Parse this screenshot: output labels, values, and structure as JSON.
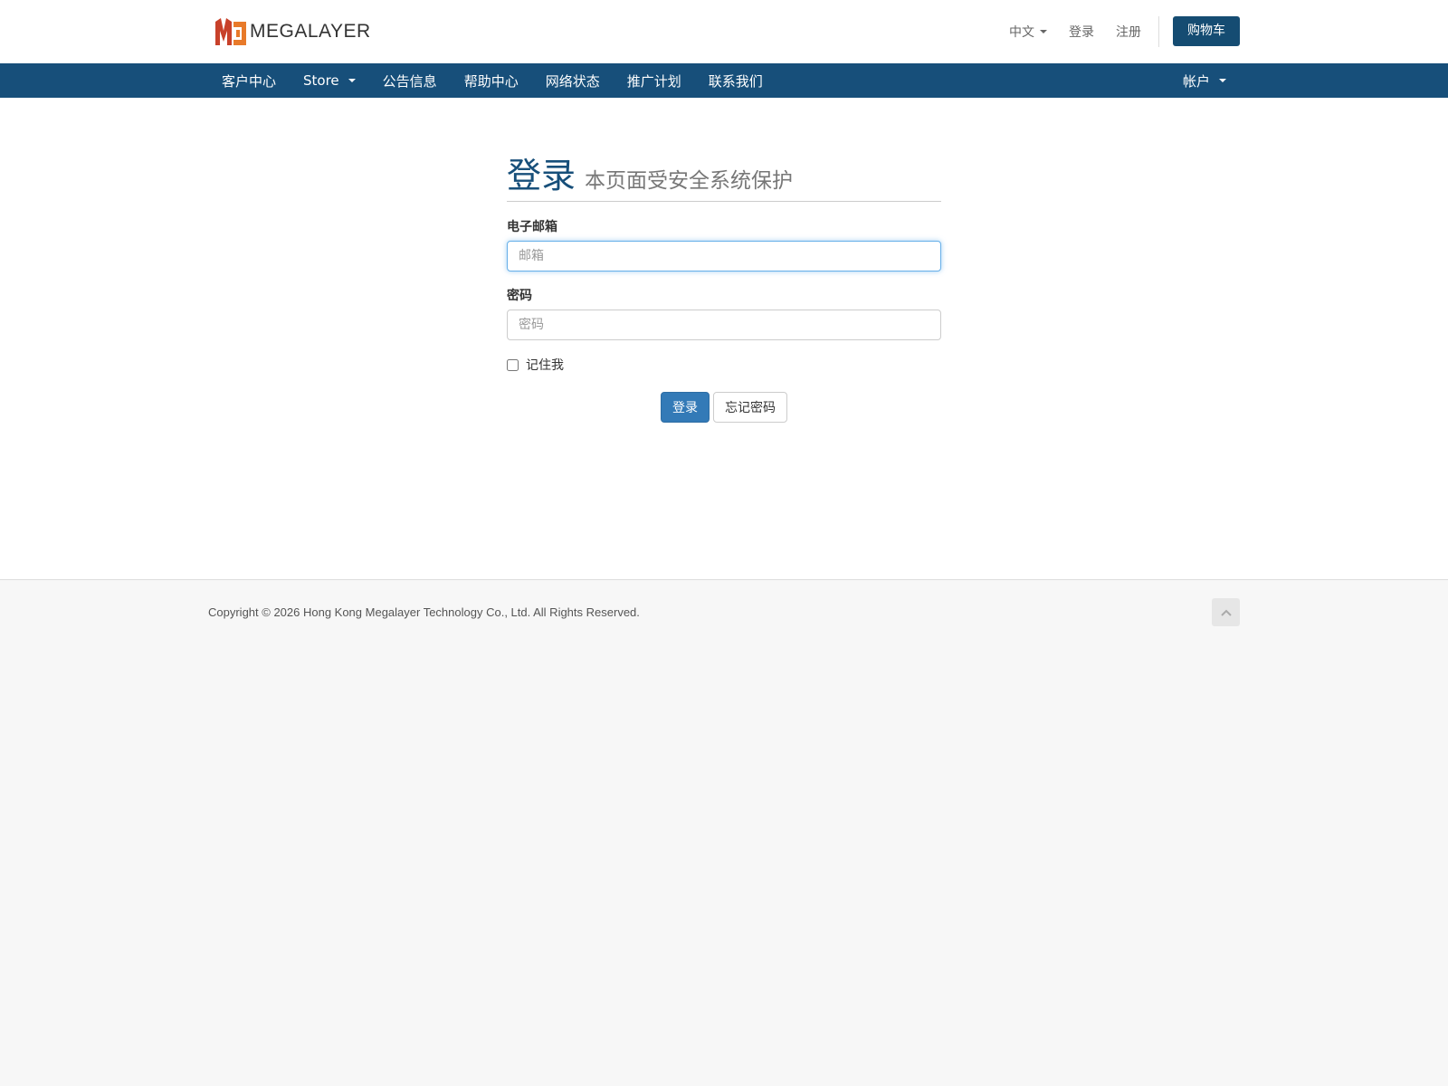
{
  "header": {
    "logo_text": "MEGALAYER",
    "links": {
      "language": "中文",
      "login": "登录",
      "register": "注册",
      "cart": "购物车"
    }
  },
  "navbar": {
    "items": [
      {
        "label": "客户中心"
      },
      {
        "label": "Store"
      },
      {
        "label": "公告信息"
      },
      {
        "label": "帮助中心"
      },
      {
        "label": "网络状态"
      },
      {
        "label": "推广计划"
      },
      {
        "label": "联系我们"
      }
    ],
    "account": "帐户"
  },
  "login": {
    "title": "登录",
    "subtitle": "本页面受安全系统保护",
    "email_label": "电子邮箱",
    "email_placeholder": "邮箱",
    "email_value": "",
    "password_label": "密码",
    "password_placeholder": "密码",
    "password_value": "",
    "remember_label": "记住我",
    "remember_checked": false,
    "submit_label": "登录",
    "forgot_label": "忘记密码"
  },
  "footer": {
    "copyright": "Copyright © 2026 Hong Kong Megalayer Technology Co., Ltd. All Rights Reserved."
  },
  "colors": {
    "brand_navy": "#174f7a",
    "primary_button": "#337ab7",
    "logo_red": "#c8412a",
    "logo_orange": "#e87a2a"
  },
  "icons": {
    "logo": "megalayer-logo-icon",
    "caret": "caret-down-icon",
    "back_to_top": "chevron-up-icon"
  }
}
